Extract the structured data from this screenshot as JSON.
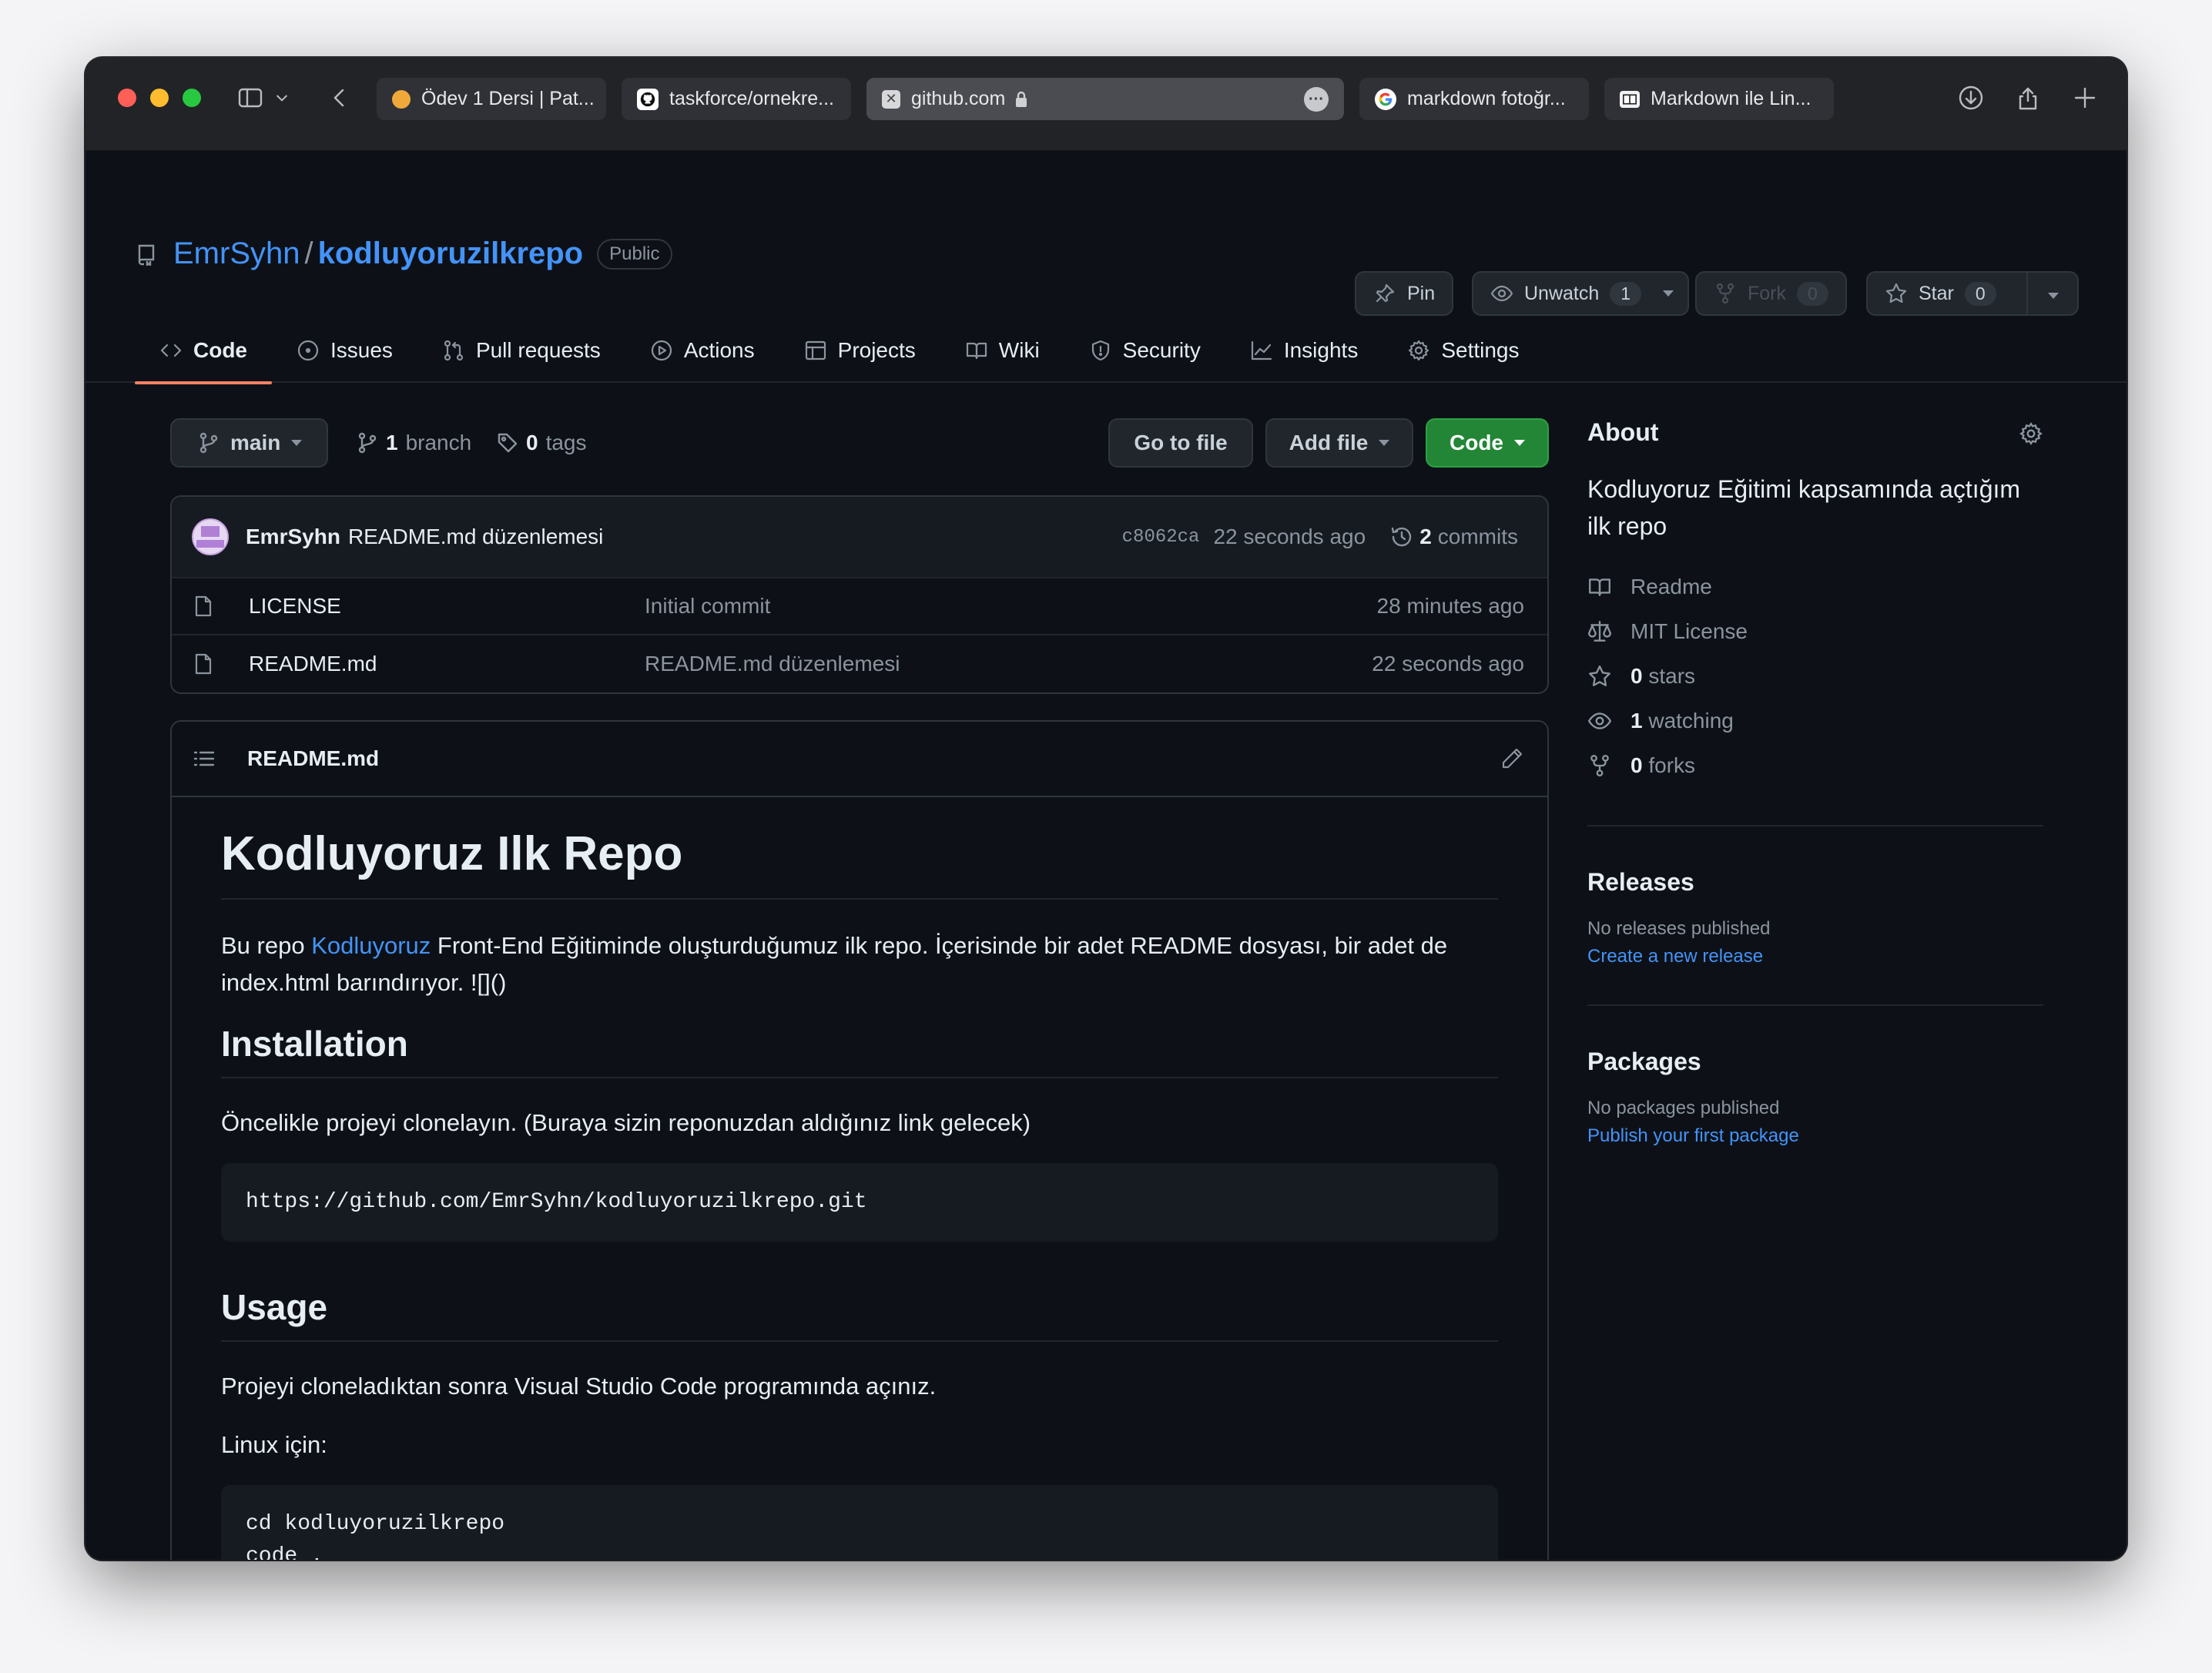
{
  "browser": {
    "tabs": [
      {
        "label": "Ödev 1 Dersi | Pat...",
        "favicon": "orange-dot-icon"
      },
      {
        "label": "taskforce/ornekre...",
        "favicon": "github-icon"
      },
      {
        "label": "github.com",
        "favicon": "close-tab-icon",
        "active": true
      },
      {
        "label": "markdown fotoğr...",
        "favicon": "google-icon"
      },
      {
        "label": "Markdown ile Lin...",
        "favicon": "book-icon"
      }
    ]
  },
  "repo": {
    "owner": "EmrSyhn",
    "separator": "/",
    "name": "kodluyoruzilkrepo",
    "visibility": "Public"
  },
  "actions": {
    "pin": "Pin",
    "unwatch": "Unwatch",
    "watch_count": "1",
    "fork": "Fork",
    "fork_count": "0",
    "star": "Star",
    "star_count": "0"
  },
  "nav": [
    {
      "label": "Code",
      "icon": "code-icon",
      "active": true
    },
    {
      "label": "Issues",
      "icon": "issue-icon"
    },
    {
      "label": "Pull requests",
      "icon": "pull-request-icon"
    },
    {
      "label": "Actions",
      "icon": "play-icon"
    },
    {
      "label": "Projects",
      "icon": "table-icon"
    },
    {
      "label": "Wiki",
      "icon": "book-icon"
    },
    {
      "label": "Security",
      "icon": "shield-icon"
    },
    {
      "label": "Insights",
      "icon": "graph-icon"
    },
    {
      "label": "Settings",
      "icon": "gear-icon"
    }
  ],
  "branchbar": {
    "branch": "main",
    "branch_count": "1",
    "branch_label": "branch",
    "tag_count": "0",
    "tag_label": "tags",
    "go_to_file": "Go to file",
    "add_file": "Add file",
    "code": "Code"
  },
  "latest_commit": {
    "author": "EmrSyhn",
    "message": "README.md düzenlemesi",
    "sha": "c8062ca",
    "time": "22 seconds ago",
    "commit_count": "2",
    "commit_label": "commits"
  },
  "files": [
    {
      "name": "LICENSE",
      "message": "Initial commit",
      "age": "28 minutes ago"
    },
    {
      "name": "README.md",
      "message": "README.md düzenlemesi",
      "age": "22 seconds ago"
    }
  ],
  "readme": {
    "filename": "README.md",
    "h1": "Kodluyoruz Ilk Repo",
    "p1_before": "Bu repo ",
    "p1_link": "Kodluyoruz",
    "p1_after": " Front-End Eğitiminde oluşturduğumuz ilk repo. İçerisinde bir adet README dosyası, bir adet de index.html barındırıyor. ![]()",
    "h2_install": "Installation",
    "p_install": "Öncelikle projeyi clonelayın. (Buraya sizin reponuzdan aldığınız link gelecek)",
    "code_install": "https://github.com/EmrSyhn/kodluyoruzilkrepo.git",
    "h2_usage": "Usage",
    "p_usage": "Projeyi cloneladıktan sonra Visual Studio Code programında açınız.",
    "p_linux": "Linux için:",
    "code_usage": "cd kodluyoruzilkrepo\ncode ."
  },
  "sidebar": {
    "about_title": "About",
    "description": "Kodluyoruz Eğitimi kapsamında açtığım ilk repo",
    "readme": "Readme",
    "license": "MIT License",
    "stars_count": "0",
    "stars_label": "stars",
    "watching_count": "1",
    "watching_label": "watching",
    "forks_count": "0",
    "forks_label": "forks",
    "releases_title": "Releases",
    "releases_none": "No releases published",
    "releases_link": "Create a new release",
    "packages_title": "Packages",
    "packages_none": "No packages published",
    "packages_link": "Publish your first package"
  },
  "colors": {
    "accent_link": "#4493f8",
    "active_tab_underline": "#f78166",
    "primary_button": "#238636",
    "background": "#0d1117"
  }
}
